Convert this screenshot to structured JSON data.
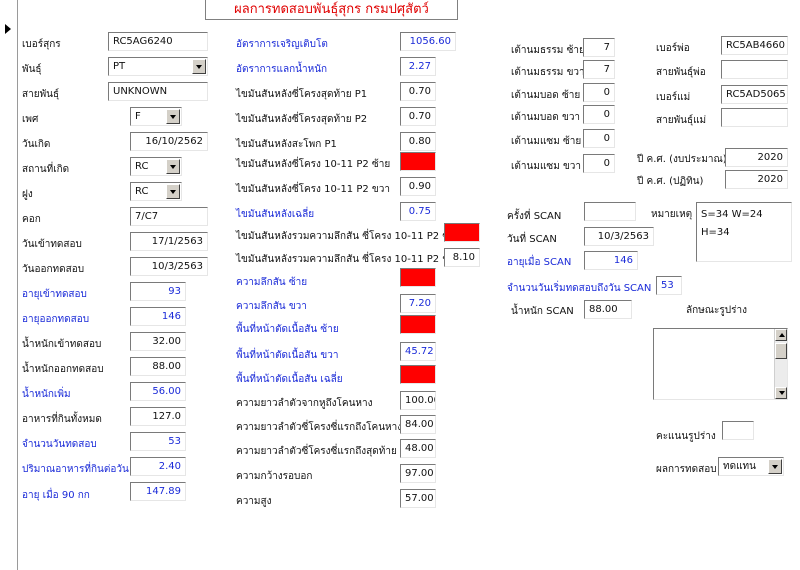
{
  "title": "ผลการทดสอบพันธุ์สุกร กรมปศุสัตว์",
  "colors": {
    "title": "#e00000",
    "blue_label": "#1a2ad8",
    "flag_red": "#ff0000"
  },
  "left": {
    "pig_no_label": "เบอร์สุกร",
    "pig_no": "RC5AG6240",
    "breed_label": "พันธุ์",
    "breed": "PT",
    "line_label": "สายพันธุ์",
    "line": "UNKNOWN",
    "sex_label": "เพศ",
    "sex": "F",
    "birth_label": "วันเกิด",
    "birth": "16/10/2562",
    "origin_label": "สถานที่เกิด",
    "origin": "RC",
    "herd_label": "ฝูง",
    "herd": "RC",
    "pen_label": "คอก",
    "pen": "7/C7",
    "date_in_label": "วันเข้าทดสอบ",
    "date_in": "17/1/2563",
    "date_out_label": "วันออกทดสอบ",
    "date_out": "10/3/2563",
    "age_in_label": "อายุเข้าทดสอบ",
    "age_in": "93",
    "age_out_label": "อายุออกทดสอบ",
    "age_out": "146",
    "wt_in_label": "น้ำหนักเข้าทดสอบ",
    "wt_in": "32.00",
    "wt_out_label": "น้ำหนักออกทดสอบ",
    "wt_out": "88.00",
    "wt_gain_label": "น้ำหนักเพิ่ม",
    "wt_gain": "56.00",
    "feed_total_label": "อาหารที่กินทั้งหมด",
    "feed_total": "127.0",
    "days_label": "จำนวนวันทดสอบ",
    "days": "53",
    "feed_per_day_label": "ปริมาณอาหารที่กินต่อวัน",
    "feed_per_day": "2.40",
    "age90_label": "อายุ เมื่อ 90 กก",
    "age90": "147.89"
  },
  "mid": {
    "adg_label": "อัตราการเจริญเติบโต",
    "adg": "1056.60",
    "fcr_label": "อัตราการแลกน้ำหนัก",
    "fcr": "2.27",
    "bf_p1_label": "ไขมันสันหลังซี่โครงสุดท้าย P1",
    "bf_p1": "0.70",
    "bf_p2_label": "ไขมันสันหลังซี่โครงสุดท้าย P2",
    "bf_p2": "0.70",
    "bf_shoulder_label": "ไขมันสันหลังสะโพก P1",
    "bf_shoulder": "0.80",
    "bf_10_11_left_label": "ไขมันสันหลังซี่โครง 10-11 P2 ซ้าย",
    "bf_10_11_right_label": "ไขมันสันหลังซี่โครง 10-11 P2 ขวา",
    "bf_10_11_right": "0.90",
    "bf_avg_label": "ไขมันสันหลังเฉลี่ย",
    "bf_avg": "0.75",
    "depth_left_total_label": "ไขมันสันหลังรวมความลึกสัน ซี่โครง 10-11 P2 ซ้าย",
    "depth_right_total_label": "ไขมันสันหลังรวมความลึกสัน ซี่โครง 10-11 P2 ขวา",
    "depth_right_total": "8.10",
    "loin_depth_left_label": "ความลึกสัน ซ้าย",
    "loin_depth_right_label": "ความลึกสัน ขวา",
    "loin_depth_right": "7.20",
    "loin_area_left_label": "พื้นที่หน้าตัดเนื้อสัน ซ้าย",
    "loin_area_right_label": "พื้นที่หน้าตัดเนื้อสัน ขวา",
    "loin_area_right": "45.72",
    "loin_area_avg_label": "พื้นที่หน้าตัดเนื้อสัน เฉลี่ย",
    "body_len_label": "ความยาวลำตัวจากหูถึงโคนหาง",
    "body_len": "100.00",
    "len_first_rib_label": "ความยาวลำตัวซี่โครงซี่แรกถึงโคนหาง",
    "len_first_rib": "84.00",
    "len_last_rib_label": "ความยาวลำตัวซี่โครงซี่แรกถึงสุดท้าย",
    "len_last_rib": "48.00",
    "chest_label": "ความกว้างรอบอก",
    "chest": "97.00",
    "height_label": "ความสูง",
    "height": "57.00"
  },
  "teats": {
    "normal_left_label": "เต้านมธรรม ซ้าย",
    "normal_left": "7",
    "normal_right_label": "เต้านมธรรม ขวา",
    "normal_right": "7",
    "blind_left_label": "เต้านมบอด ซ้าย",
    "blind_left": "0",
    "blind_right_label": "เต้านมบอด ขวา",
    "blind_right": "0",
    "extra_left_label": "เต้านมแซม ซ้าย",
    "extra_left": "0",
    "extra_right_label": "เต้านมแซม ขวา",
    "extra_right": "0"
  },
  "scan": {
    "times_label": "ครั้งที่ SCAN",
    "times": "",
    "date_label": "วันที่ SCAN",
    "date": "10/3/2563",
    "age_label": "อายุเมื่อ SCAN",
    "age": "146",
    "days_from_start_label": "จำนวนวันเริ่มทดสอบถึงวัน SCAN",
    "days_from_start": "53",
    "weight_label": "น้ำหนัก SCAN",
    "weight": "88.00"
  },
  "right": {
    "sire_label": "เบอร์พ่อ",
    "sire": "RC5AB4660",
    "sire_line_label": "สายพันธุ์พ่อ",
    "sire_line": "",
    "dam_label": "เบอร์แม่",
    "dam": "RC5AD5065",
    "dam_line_label": "สายพันธุ์แม่",
    "dam_line": "",
    "fy_budget_label": "ปี ค.ศ. (งบประมาณ)",
    "fy_budget": "2020",
    "fy_cal_label": "ปี ค.ศ. (ปฏิทิน)",
    "fy_cal": "2020",
    "remark_label": "หมายเหตุ",
    "remark": "S=34 W=24\nH=34",
    "conformation_label": "ลักษณะรูปร่าง",
    "conformation": "",
    "conformation_score_label": "คะแนนรูปร่าง",
    "conformation_score": "",
    "result_label": "ผลการทดสอบ",
    "result": "ทดแทน"
  }
}
